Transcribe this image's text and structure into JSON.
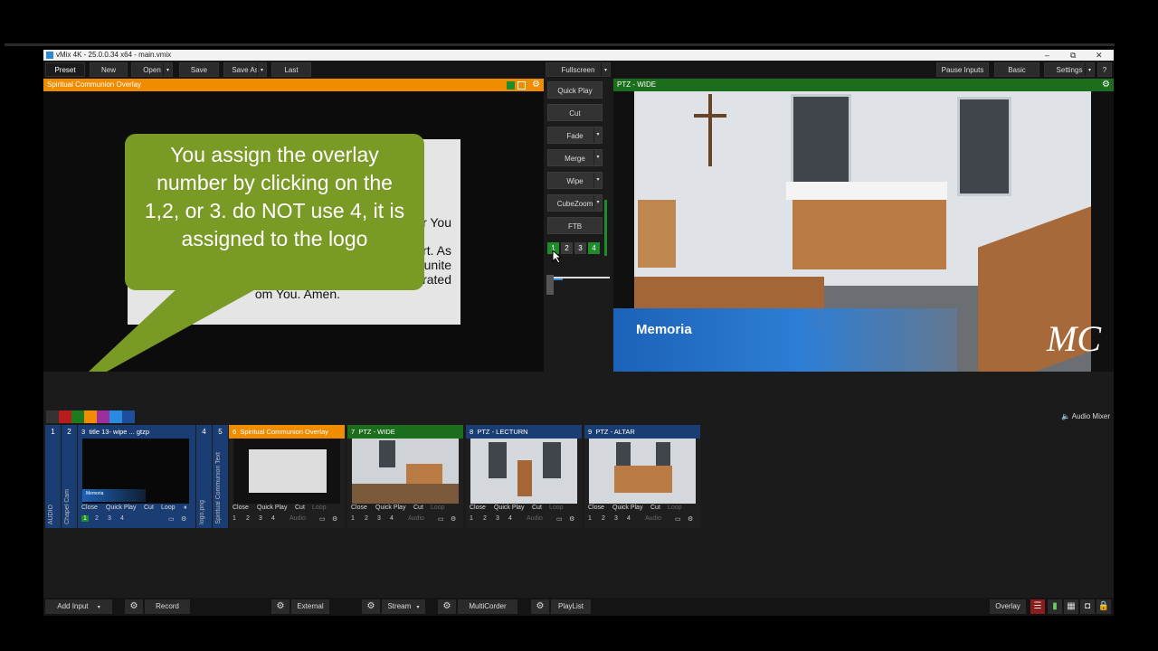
{
  "window": {
    "title": "vMix 4K - 25.0.0.34 x64 - main.vmix",
    "min": "–",
    "max": "⧉",
    "close": "✕"
  },
  "menu": {
    "preset": "Preset",
    "new": "New",
    "open": "Open",
    "save": "Save",
    "save_as": "Save As",
    "last": "Last",
    "fullscreen": "Fullscreen",
    "pause_inputs": "Pause Inputs",
    "basic": "Basic",
    "settings": "Settings",
    "help": "?"
  },
  "preview": {
    "title": "Spiritual Communion Overlay",
    "slide_lines": [
      "or You",
      "rt. As",
      "unite",
      "rated",
      "om You. Amen."
    ]
  },
  "callout": {
    "text": "You assign the overlay number by clicking on the 1,2, or 3. do NOT use 4, it is assigned to the logo"
  },
  "transitions": {
    "quick_play": "Quick Play",
    "cut": "Cut",
    "fade": "Fade",
    "merge": "Merge",
    "wipe": "Wipe",
    "cubezoom": "CubeZoom",
    "ftb": "FTB",
    "overlay_numbers": [
      "1",
      "2",
      "3",
      "4"
    ]
  },
  "output": {
    "title": "PTZ - WIDE",
    "lower_third": "Memoria",
    "logo": "MC"
  },
  "colors": {
    "preview_header": "#f08c00",
    "output_header": "#1b6e1b",
    "input_blue": "#1a3e73",
    "callout_green": "#7a9a26",
    "swatches": [
      "#333333",
      "#b81c1c",
      "#1e7a1e",
      "#f08c00",
      "#9b2fa0",
      "#2a8ae0",
      "#1c4e9c"
    ]
  },
  "audio_mixer": "Audio Mixer",
  "inputs": {
    "strip": [
      {
        "num": "1",
        "vlabel": "AUDIO"
      },
      {
        "num": "2",
        "vlabel": "Chapel Cam"
      },
      {
        "num": "4",
        "vlabel": "logo.png"
      },
      {
        "num": "5",
        "vlabel": "Spiritual Communion Text"
      }
    ],
    "tiles": [
      {
        "num": "3",
        "title": "title 13- wipe ... gtzp",
        "thumb_label": "Memoria"
      },
      {
        "num": "6",
        "title": "Spiritual Communion Overlay"
      },
      {
        "num": "7",
        "title": "PTZ - WIDE"
      },
      {
        "num": "8",
        "title": "PTZ - LECTURN"
      },
      {
        "num": "9",
        "title": "PTZ - ALTAR"
      }
    ],
    "controls": {
      "close": "Close",
      "quick_play": "Quick Play",
      "cut": "Cut",
      "loop": "Loop",
      "audio": "Audio"
    },
    "overlay_nums": [
      "1",
      "2",
      "3",
      "4"
    ]
  },
  "bottom": {
    "add_input": "Add Input",
    "record": "Record",
    "external": "External",
    "stream": "Stream",
    "multicorder": "MultiCorder",
    "playlist": "PlayList",
    "overlay": "Overlay"
  }
}
